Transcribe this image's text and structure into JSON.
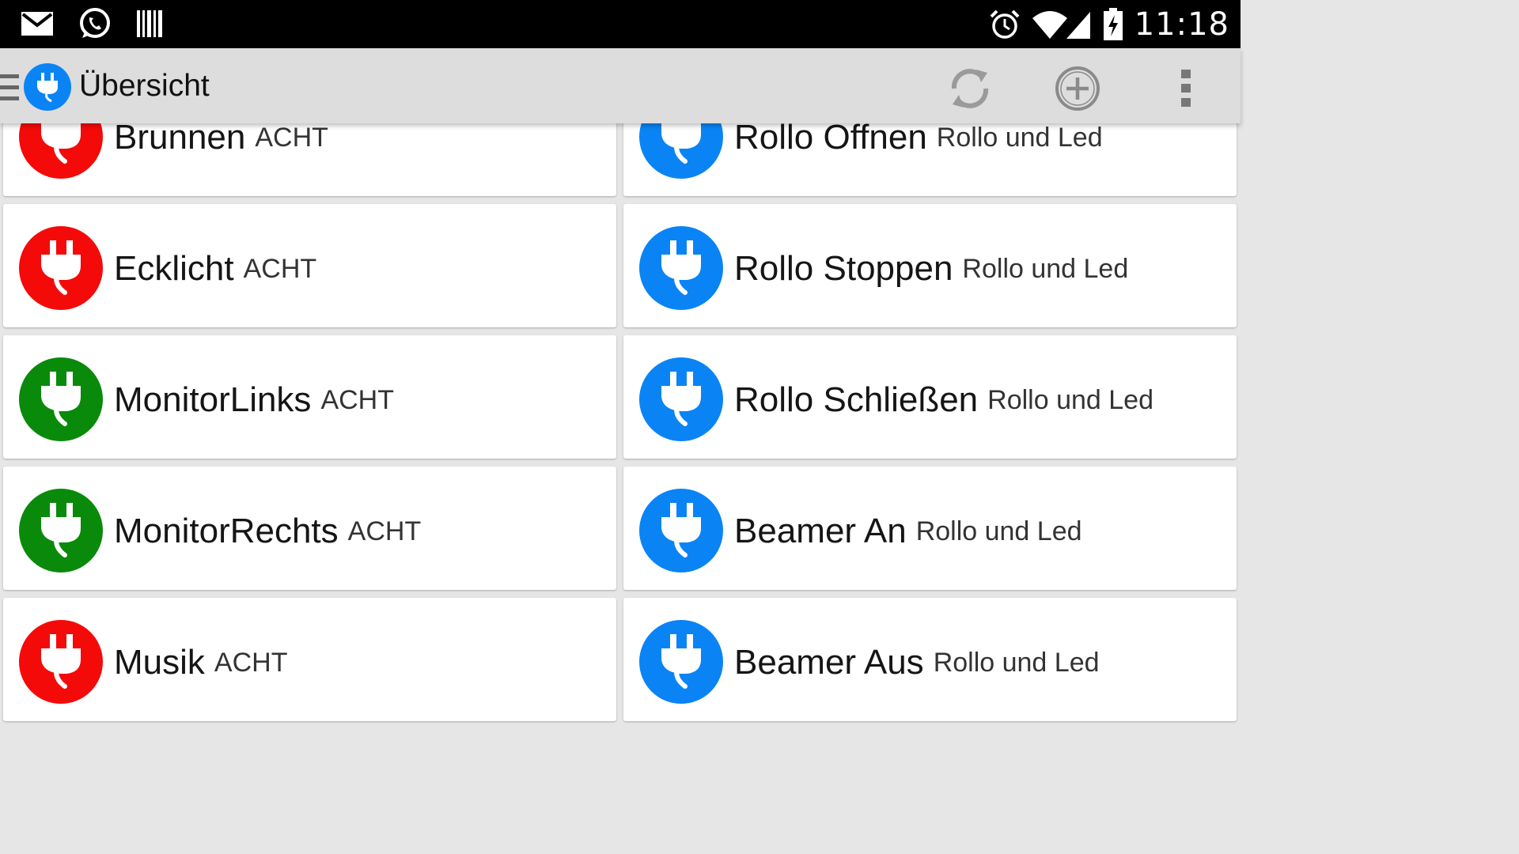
{
  "status_bar": {
    "time": "11:18",
    "left_icons": [
      "gmail-icon",
      "whatsapp-icon",
      "barcode-icon"
    ],
    "right_icons": [
      "alarm-icon",
      "wifi-icon",
      "signal-icon",
      "battery-charging-icon"
    ]
  },
  "action_bar": {
    "title": "Übersicht",
    "actions": [
      "refresh-icon",
      "add-icon",
      "overflow-menu-icon"
    ]
  },
  "colors": {
    "red": "#f50a0a",
    "green": "#0a8a0a",
    "blue": "#0a84f5"
  },
  "devices": [
    {
      "name": "Brunnen",
      "group": "ACHT",
      "color": "red"
    },
    {
      "name": "Rollo Öffnen",
      "group": "Rollo und Led",
      "color": "blue"
    },
    {
      "name": "Ecklicht",
      "group": "ACHT",
      "color": "red"
    },
    {
      "name": "Rollo Stoppen",
      "group": "Rollo und Led",
      "color": "blue"
    },
    {
      "name": "MonitorLinks",
      "group": "ACHT",
      "color": "green"
    },
    {
      "name": "Rollo Schließen",
      "group": "Rollo und Led",
      "color": "blue"
    },
    {
      "name": "MonitorRechts",
      "group": "ACHT",
      "color": "green"
    },
    {
      "name": "Beamer An",
      "group": "Rollo und Led",
      "color": "blue"
    },
    {
      "name": "Musik",
      "group": "ACHT",
      "color": "red"
    },
    {
      "name": "Beamer Aus",
      "group": "Rollo und Led",
      "color": "blue"
    }
  ]
}
